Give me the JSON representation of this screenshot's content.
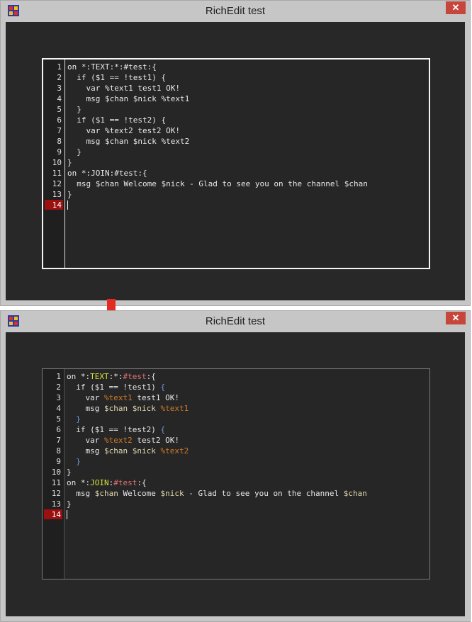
{
  "colors": {
    "event": "#d8e040",
    "channel": "#e07070",
    "variable": "#d07a2a",
    "identifier": "#e0d8b0",
    "brace": "#6a9ad8",
    "active_line": "#9c1010",
    "arrow": "#e32b24",
    "close": "#c7463b"
  },
  "windows": [
    {
      "title": "RichEdit test",
      "close_label": "✕",
      "active_line_number": 14,
      "line_numbers": [
        "1",
        "2",
        "3",
        "4",
        "5",
        "6",
        "7",
        "8",
        "9",
        "10",
        "11",
        "12",
        "13",
        "14"
      ],
      "code_lines": [
        "on *:TEXT:*:#test:{",
        "  if ($1 == !test1) {",
        "    var %text1 test1 OK!",
        "    msg $chan $nick %text1",
        "  }",
        "  if ($1 == !test2) {",
        "    var %text2 test2 OK!",
        "    msg $chan $nick %text2",
        "  }",
        "}",
        "on *:JOIN:#test:{",
        "  msg $chan Welcome $nick - Glad to see you on the channel $chan",
        "}",
        ""
      ]
    },
    {
      "title": "RichEdit test",
      "close_label": "✕",
      "active_line_number": 14,
      "line_numbers": [
        "1",
        "2",
        "3",
        "4",
        "5",
        "6",
        "7",
        "8",
        "9",
        "10",
        "11",
        "12",
        "13",
        "14"
      ],
      "code_lines": [
        "on *:TEXT:*:#test:{",
        "  if ($1 == !test1) {",
        "    var %text1 test1 OK!",
        "    msg $chan $nick %text1",
        "  }",
        "  if ($1 == !test2) {",
        "    var %text2 test2 OK!",
        "    msg $chan $nick %text2",
        "  }",
        "}",
        "on *:JOIN:#test:{",
        "  msg $chan Welcome $nick - Glad to see you on the channel $chan",
        "}",
        ""
      ]
    }
  ]
}
